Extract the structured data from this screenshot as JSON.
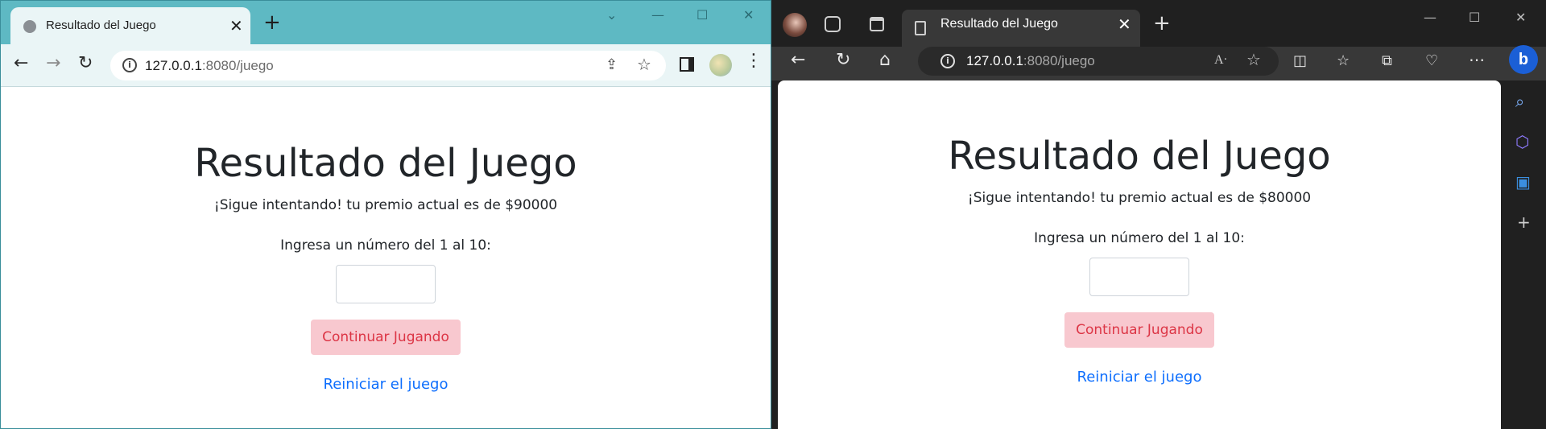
{
  "left_window": {
    "tab_title": "Resultado del Juego",
    "url_host": "127.0.0.1",
    "url_rest": ":8080/juego",
    "page": {
      "heading": "Resultado del Juego",
      "message": "¡Sigue intentando! tu premio actual es de $90000",
      "input_label": "Ingresa un número del 1 al 10:",
      "continue_button": "Continuar Jugando",
      "restart_link": "Reiniciar el juego"
    }
  },
  "right_window": {
    "tab_title": "Resultado del Juego",
    "url_host": "127.0.0.1",
    "url_rest": ":8080/juego",
    "page": {
      "heading": "Resultado del Juego",
      "message": "¡Sigue intentando! tu premio actual es de $80000",
      "input_label": "Ingresa un número del 1 al 10:",
      "continue_button": "Continuar Jugando",
      "restart_link": "Reiniciar el juego"
    }
  },
  "colors": {
    "chrome_frame": "#5eb9c3",
    "edge_frame": "#202020",
    "button_bg": "#f8c8cf",
    "button_text": "#dc3545",
    "link": "#0d6efd"
  }
}
